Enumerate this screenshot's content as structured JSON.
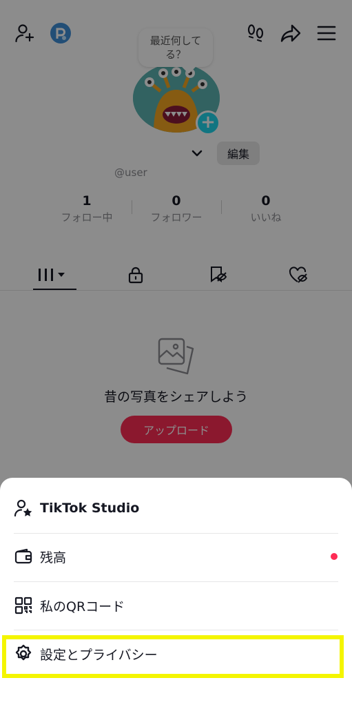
{
  "profile": {
    "bubble_text": "最近何してる？",
    "edit_label": "編集",
    "username": "@user",
    "stats": [
      {
        "value": "1",
        "label": "フォロー中"
      },
      {
        "value": "0",
        "label": "フォロワー"
      },
      {
        "value": "0",
        "label": "いいね"
      }
    ]
  },
  "empty_state": {
    "title": "昔の写真をシェアしよう",
    "upload_label": "アップロード"
  },
  "menu": {
    "items": [
      {
        "label": "TikTok Studio",
        "icon": "person-star-icon"
      },
      {
        "label": "残高",
        "icon": "wallet-icon"
      },
      {
        "label": "私のQRコード",
        "icon": "qr-code-icon"
      },
      {
        "label": "設定とプライバシー",
        "icon": "gear-icon"
      }
    ]
  },
  "colors": {
    "accent": "#fe2c55",
    "highlight": "#f4f500",
    "badge": "#20d5ec"
  }
}
